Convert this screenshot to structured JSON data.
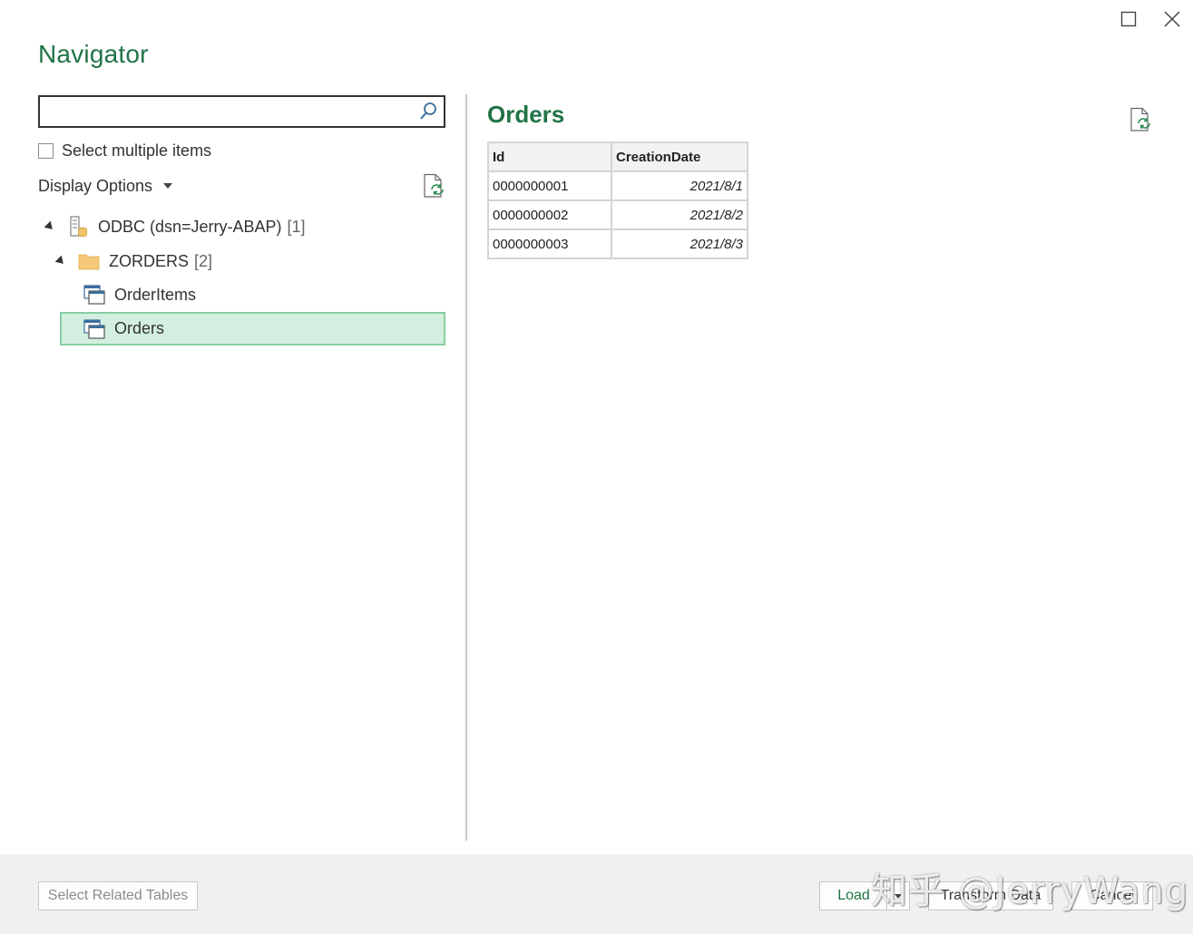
{
  "window": {
    "title": "Navigator"
  },
  "left_pane": {
    "search": {
      "value": "",
      "placeholder": ""
    },
    "select_multiple_label": "Select multiple items",
    "display_options_label": "Display Options",
    "tree": {
      "source": {
        "label": "ODBC (dsn=Jerry-ABAP)",
        "count": "[1]"
      },
      "schema": {
        "label": "ZORDERS",
        "count": "[2]"
      },
      "tables": [
        {
          "label": "OrderItems",
          "selected": false
        },
        {
          "label": "Orders",
          "selected": true
        }
      ]
    }
  },
  "preview": {
    "title": "Orders",
    "columns": [
      "Id",
      "CreationDate"
    ],
    "rows": [
      [
        "0000000001",
        "2021/8/1"
      ],
      [
        "0000000002",
        "2021/8/2"
      ],
      [
        "0000000003",
        "2021/8/3"
      ]
    ]
  },
  "footer": {
    "select_related_label": "Select Related Tables",
    "load_label": "Load",
    "transform_label": "Transform Data",
    "cancel_label": "Cancel"
  },
  "watermark": "知乎 @JerryWang",
  "colors": {
    "accent": "#217346",
    "selection_bg": "#d3efdf",
    "selection_border": "#86cfa3"
  }
}
